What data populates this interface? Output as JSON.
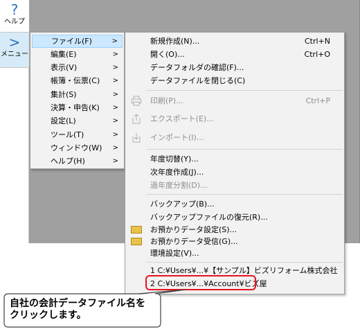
{
  "rail": {
    "help_icon": "?",
    "help_label": "ヘルプ",
    "menu_icon": ">",
    "menu_label": "メニュー"
  },
  "main_menu": [
    {
      "label": "ファイル(F)",
      "arrow": ">",
      "active": true
    },
    {
      "label": "編集(E)",
      "arrow": ">"
    },
    {
      "label": "表示(V)",
      "arrow": ">"
    },
    {
      "label": "帳簿・伝票(C)",
      "arrow": ">"
    },
    {
      "label": "集計(S)",
      "arrow": ">"
    },
    {
      "label": "決算・申告(K)",
      "arrow": ">"
    },
    {
      "label": "設定(L)",
      "arrow": ">"
    },
    {
      "label": "ツール(T)",
      "arrow": ">"
    },
    {
      "label": "ウィンドウ(W)",
      "arrow": ">"
    },
    {
      "label": "ヘルプ(H)",
      "arrow": ">"
    }
  ],
  "file_menu": {
    "new": {
      "label": "新規作成(N)...",
      "shortcut": "Ctrl+N"
    },
    "open": {
      "label": "開く(O)...",
      "shortcut": "Ctrl+O"
    },
    "data_folder": {
      "label": "データフォルダの確認(F)..."
    },
    "close_data": {
      "label": "データファイルを閉じる(C)"
    },
    "print": {
      "label": "印刷(P)...",
      "shortcut": "Ctrl+P",
      "icon": "printer-icon"
    },
    "export": {
      "label": "エクスポート(E)...",
      "icon": "export-icon"
    },
    "import": {
      "label": "インポート(I)...",
      "icon": "import-icon"
    },
    "year_switch": {
      "label": "年度切替(Y)..."
    },
    "next_year": {
      "label": "次年度作成(J)..."
    },
    "past_split": {
      "label": "過年度分割(D)..."
    },
    "backup": {
      "label": "バックアップ(B)..."
    },
    "restore": {
      "label": "バックアップファイルの復元(R)..."
    },
    "deposit_setting": {
      "label": "お預かりデータ設定(S)...",
      "icon": "deposit-icon"
    },
    "deposit_receive": {
      "label": "お預かりデータ受信(G)...",
      "icon": "deposit-icon"
    },
    "environment": {
      "label": "環境設定(V)..."
    },
    "recent1": {
      "label": "1 C:¥Users¥...¥【サンプル】ビズリフォーム株式会社"
    },
    "recent2": {
      "label": "2 C:¥Users¥...¥Account¥ビズ屋"
    }
  },
  "callout": {
    "line1": "自社の会計データファイル名を",
    "line2": "クリックします。"
  },
  "colors": {
    "highlight": "#e8121e",
    "active_item": "#cce8ff",
    "rail_accent": "#2e6fb5"
  }
}
